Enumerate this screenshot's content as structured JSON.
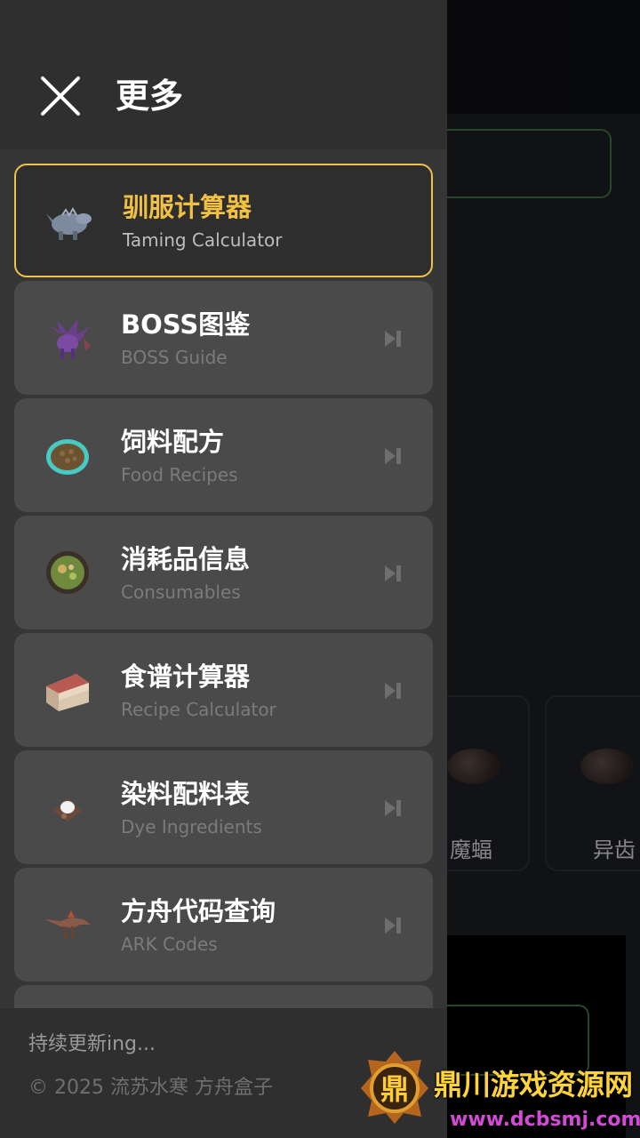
{
  "drawer": {
    "title": "更多",
    "items": [
      {
        "zh": "驯服计算器",
        "en": "Taming Calculator",
        "icon": "dino-icon",
        "active": true
      },
      {
        "zh": "BOSS图鉴",
        "en": "BOSS Guide",
        "icon": "dragon-icon",
        "active": false
      },
      {
        "zh": "饲料配方",
        "en": "Food Recipes",
        "icon": "kibble-icon",
        "active": false
      },
      {
        "zh": "消耗品信息",
        "en": "Consumables",
        "icon": "bowl-icon",
        "active": false
      },
      {
        "zh": "食谱计算器",
        "en": "Recipe Calculator",
        "icon": "cake-icon",
        "active": false
      },
      {
        "zh": "染料配料表",
        "en": "Dye Ingredients",
        "icon": "dye-icon",
        "active": false
      },
      {
        "zh": "方舟代码查询",
        "en": "ARK Codes",
        "icon": "raptor-icon",
        "active": false
      }
    ],
    "footer": {
      "status": "持续更新ing...",
      "copyright": "© 2025 流苏水寒 方舟盒子"
    }
  },
  "background": {
    "cards": [
      {
        "label": "魔蝠"
      },
      {
        "label": "异齿"
      }
    ]
  },
  "watermark": {
    "badge_glyph": "鼎",
    "name": "鼎川游戏资源网",
    "url": "www.dcbsmj.com"
  },
  "colors": {
    "accent": "#f2c043",
    "drawer_bg": "#363636",
    "item_bg": "#4a4a4a",
    "active_border": "#f0c24a"
  }
}
